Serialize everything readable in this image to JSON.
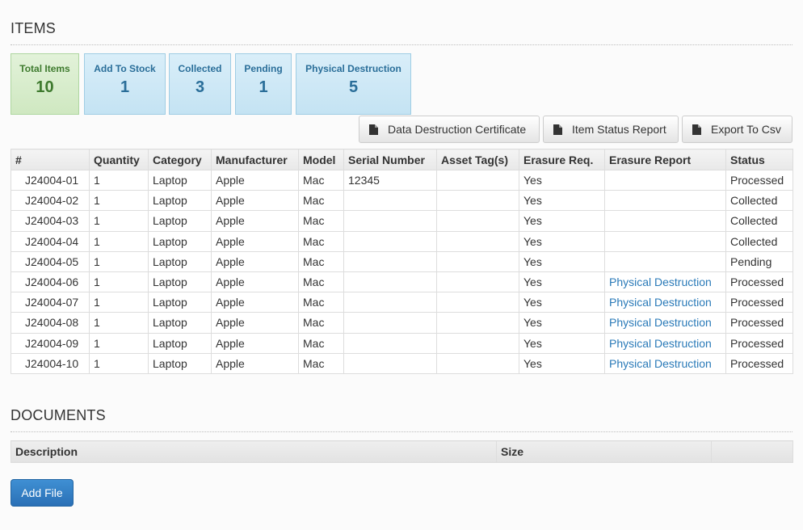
{
  "items_section": {
    "title": "ITEMS",
    "stats": [
      {
        "label": "Total Items",
        "value": "10"
      },
      {
        "label": "Add To Stock",
        "value": "1"
      },
      {
        "label": "Collected",
        "value": "3"
      },
      {
        "label": "Pending",
        "value": "1"
      },
      {
        "label": "Physical Destruction",
        "value": "5"
      }
    ],
    "buttons": {
      "certificate": "Data Destruction Certificate",
      "status_report": "Item Status Report",
      "export_csv": "Export To Csv"
    },
    "table": {
      "columns": [
        "#",
        "Quantity",
        "Category",
        "Manufacturer",
        "Model",
        "Serial Number",
        "Asset Tag(s)",
        "Erasure Req.",
        "Erasure Report",
        "Status"
      ],
      "rows": [
        {
          "ref": "J24004-01",
          "quantity": "1",
          "category": "Laptop",
          "manufacturer": "Apple",
          "model": "Mac",
          "serial": "12345",
          "asset_tag": "",
          "erasure_req": "Yes",
          "erasure_report": "",
          "status": "Processed"
        },
        {
          "ref": "J24004-02",
          "quantity": "1",
          "category": "Laptop",
          "manufacturer": "Apple",
          "model": "Mac",
          "serial": "",
          "asset_tag": "",
          "erasure_req": "Yes",
          "erasure_report": "",
          "status": "Collected"
        },
        {
          "ref": "J24004-03",
          "quantity": "1",
          "category": "Laptop",
          "manufacturer": "Apple",
          "model": "Mac",
          "serial": "",
          "asset_tag": "",
          "erasure_req": "Yes",
          "erasure_report": "",
          "status": "Collected"
        },
        {
          "ref": "J24004-04",
          "quantity": "1",
          "category": "Laptop",
          "manufacturer": "Apple",
          "model": "Mac",
          "serial": "",
          "asset_tag": "",
          "erasure_req": "Yes",
          "erasure_report": "",
          "status": "Collected"
        },
        {
          "ref": "J24004-05",
          "quantity": "1",
          "category": "Laptop",
          "manufacturer": "Apple",
          "model": "Mac",
          "serial": "",
          "asset_tag": "",
          "erasure_req": "Yes",
          "erasure_report": "",
          "status": "Pending"
        },
        {
          "ref": "J24004-06",
          "quantity": "1",
          "category": "Laptop",
          "manufacturer": "Apple",
          "model": "Mac",
          "serial": "",
          "asset_tag": "",
          "erasure_req": "Yes",
          "erasure_report": "Physical Destruction",
          "status": "Processed"
        },
        {
          "ref": "J24004-07",
          "quantity": "1",
          "category": "Laptop",
          "manufacturer": "Apple",
          "model": "Mac",
          "serial": "",
          "asset_tag": "",
          "erasure_req": "Yes",
          "erasure_report": "Physical Destruction",
          "status": "Processed"
        },
        {
          "ref": "J24004-08",
          "quantity": "1",
          "category": "Laptop",
          "manufacturer": "Apple",
          "model": "Mac",
          "serial": "",
          "asset_tag": "",
          "erasure_req": "Yes",
          "erasure_report": "Physical Destruction",
          "status": "Processed"
        },
        {
          "ref": "J24004-09",
          "quantity": "1",
          "category": "Laptop",
          "manufacturer": "Apple",
          "model": "Mac",
          "serial": "",
          "asset_tag": "",
          "erasure_req": "Yes",
          "erasure_report": "Physical Destruction",
          "status": "Processed"
        },
        {
          "ref": "J24004-10",
          "quantity": "1",
          "category": "Laptop",
          "manufacturer": "Apple",
          "model": "Mac",
          "serial": "",
          "asset_tag": "",
          "erasure_req": "Yes",
          "erasure_report": "Physical Destruction",
          "status": "Processed"
        }
      ]
    }
  },
  "documents_section": {
    "title": "DOCUMENTS",
    "columns": [
      "Description",
      "Size",
      ""
    ],
    "add_file_label": "Add File"
  },
  "colors": {
    "link": "#2a7ab8",
    "primary_button": "#2f7bc2",
    "stat_blue": "#c4e3f3",
    "stat_green": "#cfe8c1"
  }
}
